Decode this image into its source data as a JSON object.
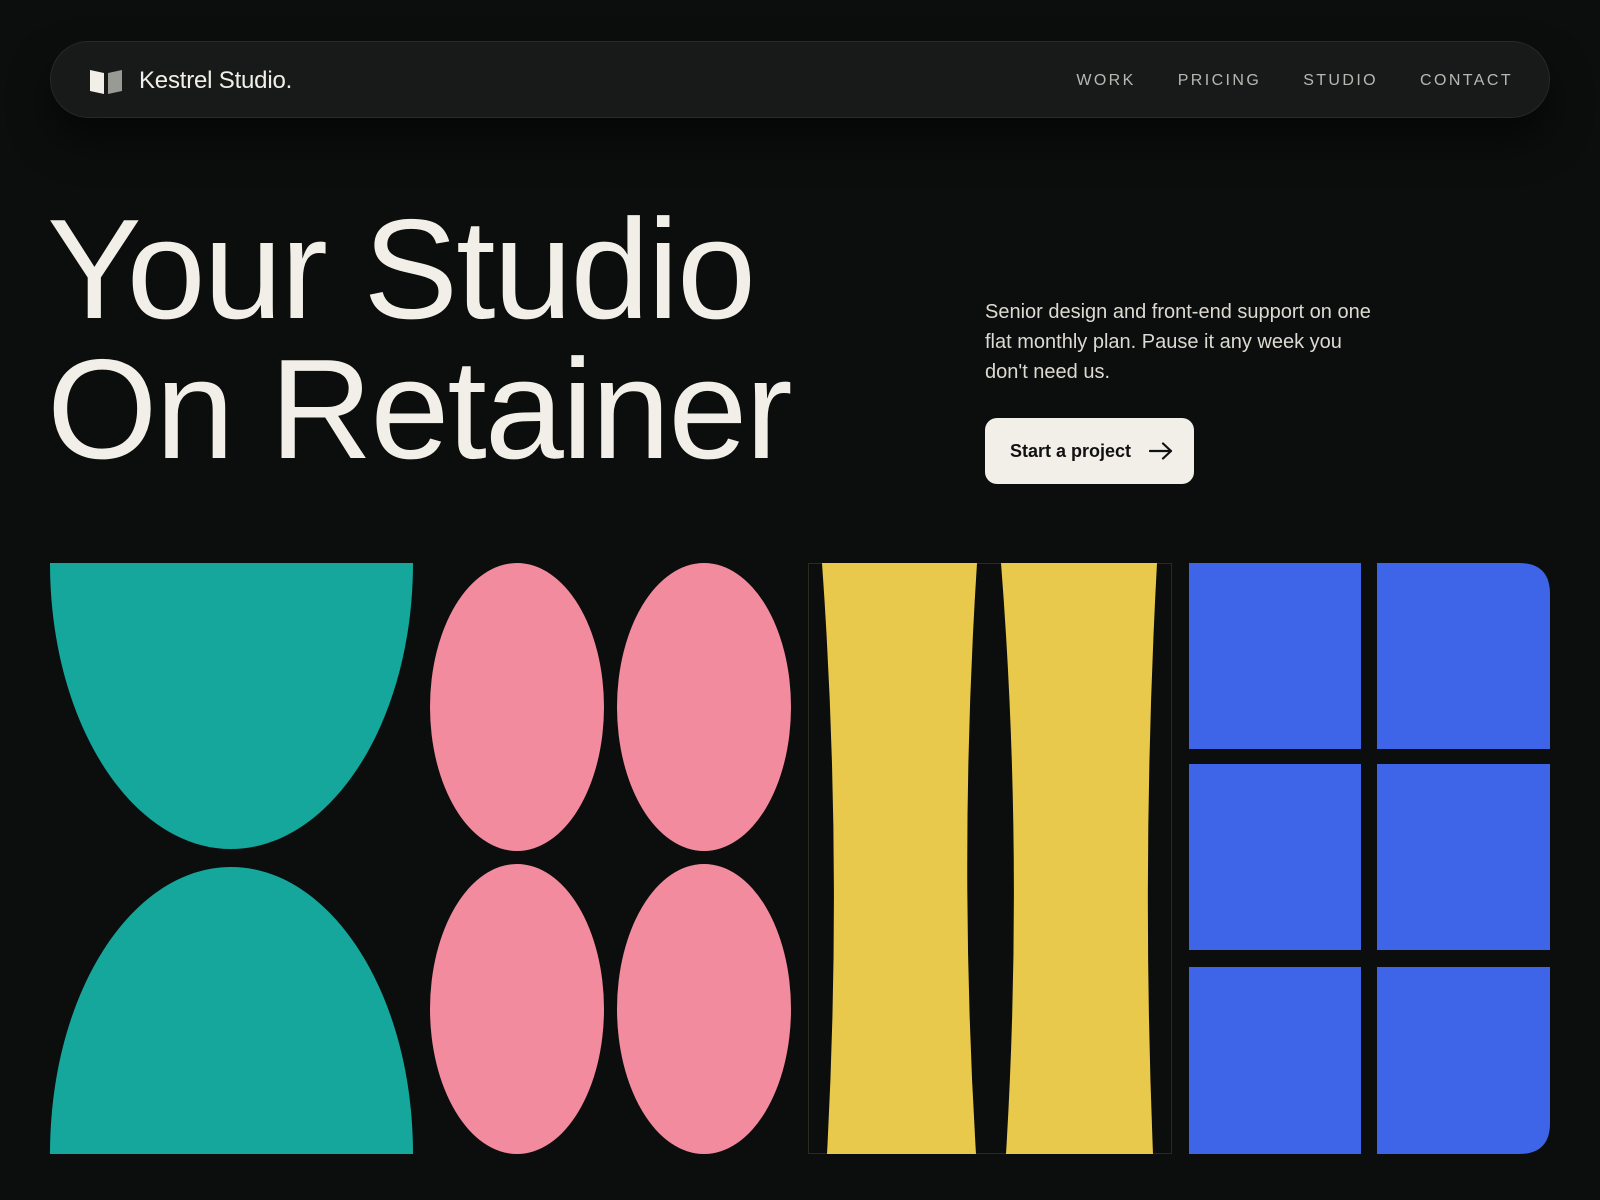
{
  "header": {
    "brand": "Kestrel Studio.",
    "logo_icon": "open-book-icon",
    "nav": [
      "WORK",
      "PRICING",
      "STUDIO",
      "CONTACT"
    ]
  },
  "hero": {
    "title_line_1": "Your Studio",
    "title_line_2": "On Retainer",
    "tagline": "Senior design and front-end support on one flat monthly plan. Pause it any week you don't need us.",
    "cta_label": "Start a project",
    "cta_icon": "arrow-right-icon"
  },
  "colors": {
    "background": "#0c0d0d",
    "text": "#f1efe7",
    "teal": "#15a79b",
    "pink": "#f38b9e",
    "yellow": "#e8c94b",
    "blue": "#3e64e8"
  }
}
